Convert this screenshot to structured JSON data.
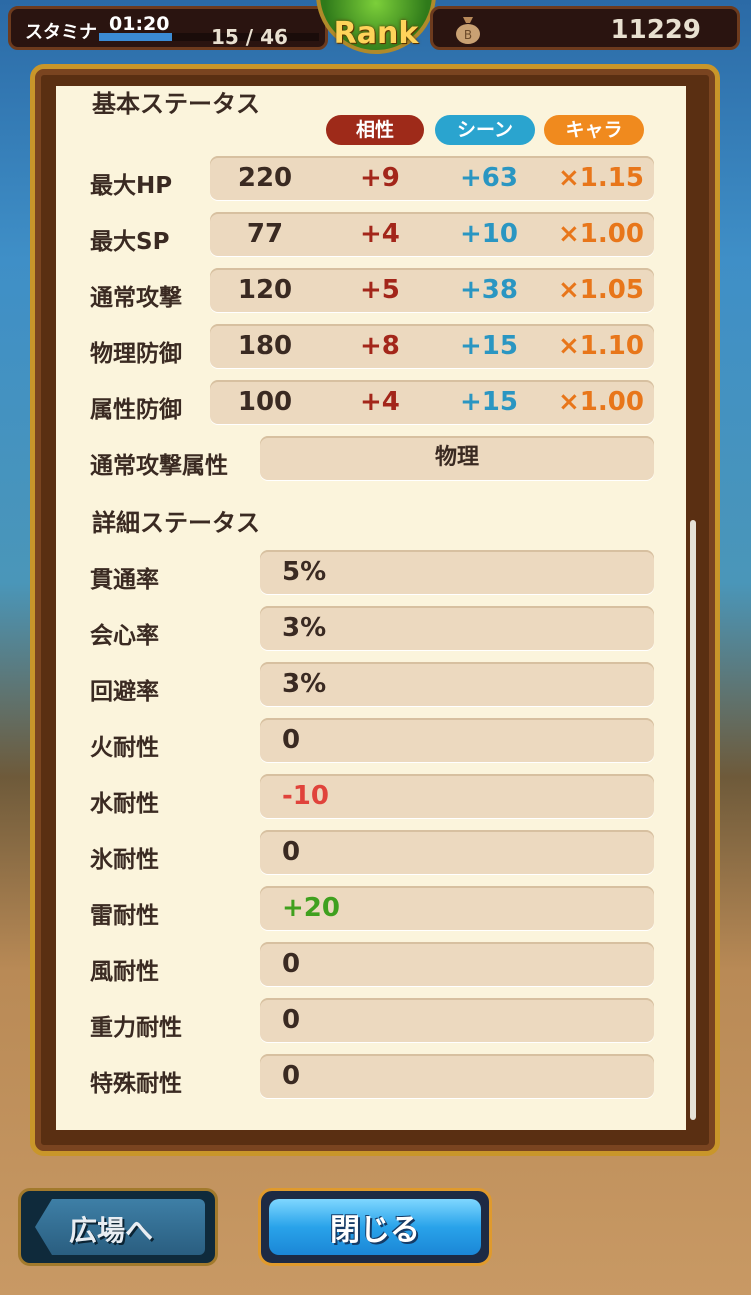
{
  "header": {
    "stamina_label": "スタミナ",
    "stamina_timer": "01:20",
    "stamina_count": "15 /  46",
    "stamina_fraction": 0.33,
    "rank_label": "Rank",
    "money_value": "11229"
  },
  "basic": {
    "title": "基本ステータス",
    "legend": {
      "affinity": "相性",
      "scene": "シーン",
      "chara": "キャラ"
    },
    "rows": [
      {
        "label": "最大HP",
        "base": "220",
        "affinity": "+9",
        "scene": "+63",
        "chara": "×1.15"
      },
      {
        "label": "最大SP",
        "base": "77",
        "affinity": "+4",
        "scene": "+10",
        "chara": "×1.00"
      },
      {
        "label": "通常攻撃",
        "base": "120",
        "affinity": "+5",
        "scene": "+38",
        "chara": "×1.05"
      },
      {
        "label": "物理防御",
        "base": "180",
        "affinity": "+8",
        "scene": "+15",
        "chara": "×1.10"
      },
      {
        "label": "属性防御",
        "base": "100",
        "affinity": "+4",
        "scene": "+15",
        "chara": "×1.00"
      }
    ],
    "attack_attr": {
      "label": "通常攻撃属性",
      "value": "物理"
    }
  },
  "detail": {
    "title": "詳細ステータス",
    "rows": [
      {
        "label": "貫通率",
        "value": "5%"
      },
      {
        "label": "会心率",
        "value": "3%"
      },
      {
        "label": "回避率",
        "value": "3%"
      },
      {
        "label": "火耐性",
        "value": "0"
      },
      {
        "label": "水耐性",
        "value": "-10"
      },
      {
        "label": "氷耐性",
        "value": "0"
      },
      {
        "label": "雷耐性",
        "value": "+20"
      },
      {
        "label": "風耐性",
        "value": "0"
      },
      {
        "label": "重力耐性",
        "value": "0"
      },
      {
        "label": "特殊耐性",
        "value": "0"
      }
    ]
  },
  "footer": {
    "plaza_button": "広場へ",
    "close_button": "閉じる"
  },
  "colors": {
    "affinity": "#a3261a",
    "scene": "#2a96c2",
    "chara": "#e8761a",
    "negative": "#e0433b",
    "positive": "#3fa01e"
  }
}
